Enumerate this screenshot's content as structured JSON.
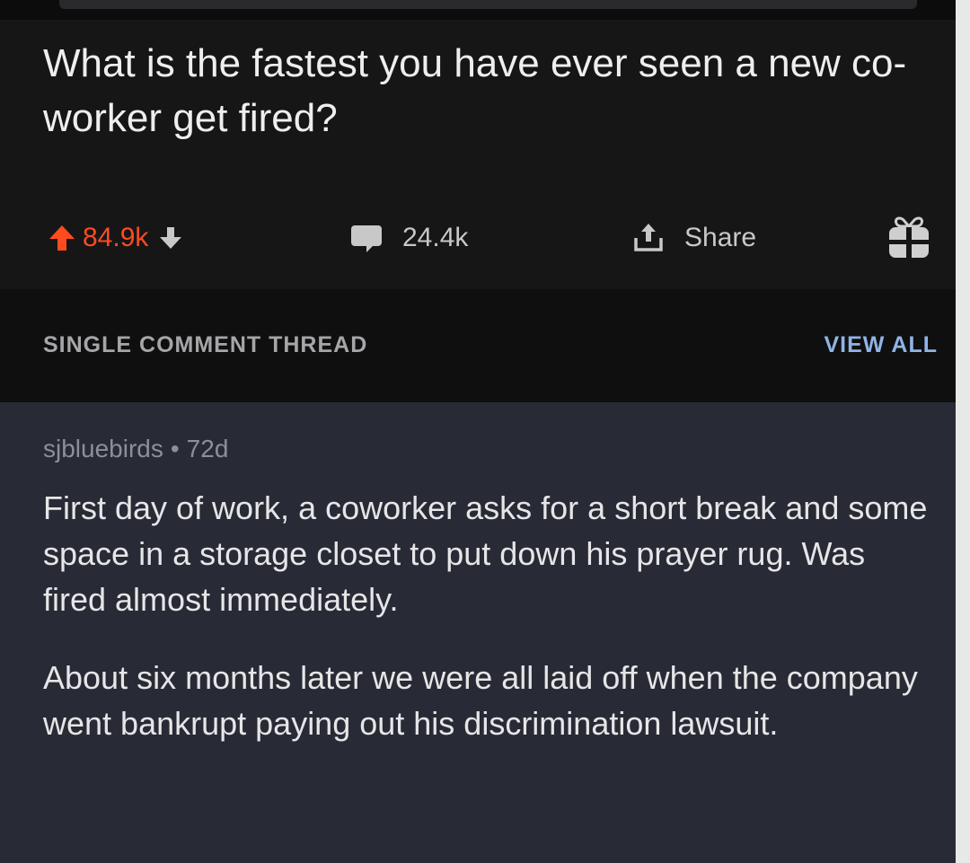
{
  "post": {
    "title": "What is the fastest you have ever seen a new co-worker get fired?",
    "upvotes": "84.9k",
    "comments": "24.4k",
    "share_label": "Share"
  },
  "thread": {
    "label": "SINGLE COMMENT THREAD",
    "view_all": "VIEW ALL"
  },
  "comment": {
    "author": "sjbluebirds",
    "separator": "•",
    "age": "72d",
    "paragraphs": [
      "First day of work, a coworker asks for a short break and some space in a storage closet to put down his prayer rug.  Was fired almost immediately.",
      "About six months later we were all laid off when the company went bankrupt paying out his discrimination lawsuit."
    ]
  },
  "colors": {
    "upvote_accent": "#ff4b1f",
    "link_blue": "#8fb4e6",
    "comment_bg": "#282b35",
    "post_bg": "#161617"
  },
  "icons": {
    "upvote": "arrow-up-icon",
    "downvote": "arrow-down-icon",
    "comment": "speech-bubble-icon",
    "share": "share-icon",
    "award": "gift-icon"
  }
}
